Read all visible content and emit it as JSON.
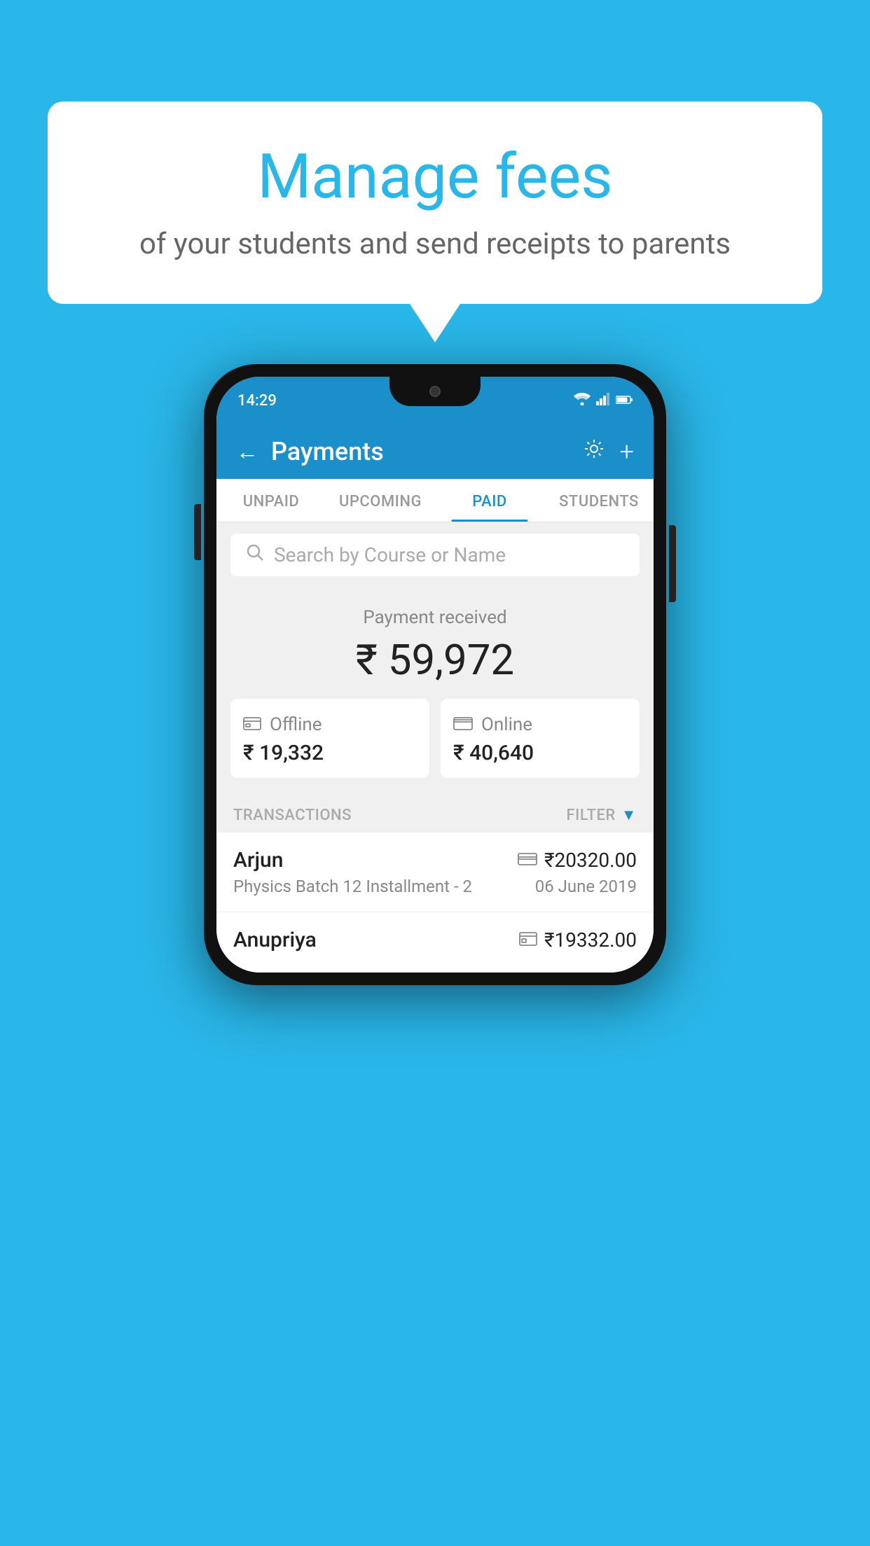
{
  "background_color": "#29b6e8",
  "speech_bubble": {
    "title": "Manage fees",
    "subtitle": "of your students and send receipts to parents"
  },
  "status_bar": {
    "time": "14:29",
    "wifi": "▲",
    "signal": "▲",
    "battery": "▮"
  },
  "header": {
    "title": "Payments",
    "back_label": "←",
    "gear_label": "⚙",
    "plus_label": "+"
  },
  "tabs": [
    {
      "label": "UNPAID",
      "active": false
    },
    {
      "label": "UPCOMING",
      "active": false
    },
    {
      "label": "PAID",
      "active": true
    },
    {
      "label": "STUDENTS",
      "active": false
    }
  ],
  "search": {
    "placeholder": "Search by Course or Name"
  },
  "payment_summary": {
    "label": "Payment received",
    "total": "₹ 59,972",
    "offline_label": "Offline",
    "offline_amount": "₹ 19,332",
    "online_label": "Online",
    "online_amount": "₹ 40,640"
  },
  "transactions_section": {
    "header_label": "TRANSACTIONS",
    "filter_label": "FILTER"
  },
  "transactions": [
    {
      "name": "Arjun",
      "amount": "₹20320.00",
      "payment_type": "card",
      "course": "Physics Batch 12 Installment - 2",
      "date": "06 June 2019"
    },
    {
      "name": "Anupriya",
      "amount": "₹19332.00",
      "payment_type": "cash",
      "course": "",
      "date": ""
    }
  ]
}
